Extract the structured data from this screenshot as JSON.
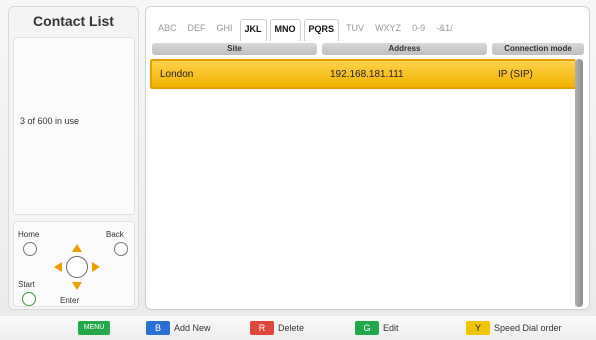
{
  "left_panel": {
    "title": "Contact List",
    "usage": "3 of 600 in use",
    "remote": {
      "home_label": "Home",
      "back_label": "Back",
      "start_label": "Start",
      "enter_label": "Enter"
    }
  },
  "tabs": [
    "ABC",
    "DEF",
    "GHI",
    "JKL",
    "MNO",
    "PQRS",
    "TUV",
    "WXYZ",
    "0-9",
    "-&1/"
  ],
  "active_tab": "JKL",
  "table": {
    "headers": [
      "Site",
      "Address",
      "Connection mode"
    ],
    "rows": [
      {
        "site": "London",
        "address": "192.168.181.111",
        "connection": "IP (SIP)"
      }
    ]
  },
  "bottom_bar": {
    "menu_key": "MENU",
    "blue_key": "B",
    "blue_label": "Add New",
    "red_key": "R",
    "red_label": "Delete",
    "green_key": "G",
    "green_label": "Edit",
    "yellow_key": "Y",
    "yellow_label": "Speed Dial order"
  },
  "colors": {
    "selection": "#f2b100",
    "blue": "#2a6fd6",
    "red": "#e0473d",
    "green": "#22a84a",
    "yellow": "#f1c400"
  }
}
